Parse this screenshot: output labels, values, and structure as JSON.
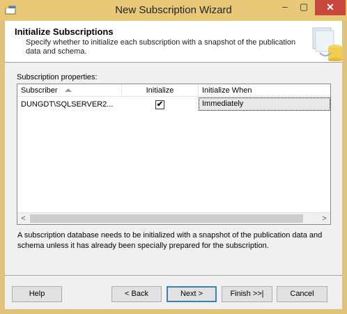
{
  "window": {
    "title": "New Subscription Wizard",
    "controls": {
      "minimize": "–",
      "maximize": "▢",
      "close": "✕"
    },
    "accent_color": "#e6c877",
    "close_color": "#c7473d"
  },
  "header": {
    "title": "Initialize Subscriptions",
    "description": "Specify whether to initialize each subscription with a snapshot of the publication data and schema."
  },
  "properties_label": "Subscription properties:",
  "grid": {
    "columns": {
      "subscriber": "Subscriber",
      "initialize": "Initialize",
      "initialize_when": "Initialize When"
    },
    "rows": [
      {
        "subscriber": "DUNGDT\\SQLSERVER2...",
        "initialize": true,
        "initialize_check": "✔",
        "initialize_when": "Immediately"
      }
    ],
    "scroll": {
      "left": "<",
      "right": ">"
    }
  },
  "note": "A subscription database needs to be initialized with a snapshot of the publication data and schema unless it has already been specially prepared for the subscription.",
  "buttons": {
    "help": "Help",
    "back": "< Back",
    "next": "Next >",
    "finish": "Finish >>|",
    "cancel": "Cancel"
  }
}
